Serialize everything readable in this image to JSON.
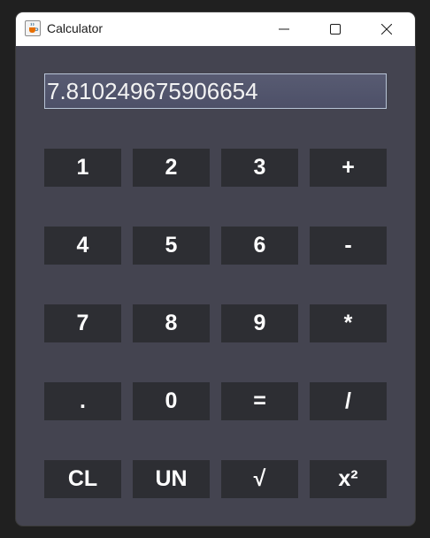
{
  "window": {
    "title": "Calculator",
    "icon": "java-cup-icon",
    "controls": [
      "minimize-icon",
      "maximize-icon",
      "close-icon"
    ]
  },
  "display": {
    "value": "7.810249675906654"
  },
  "keypad": {
    "rows": [
      [
        "1",
        "2",
        "3",
        "+"
      ],
      [
        "4",
        "5",
        "6",
        "-"
      ],
      [
        "7",
        "8",
        "9",
        "*"
      ],
      [
        ".",
        "0",
        "=",
        "/"
      ],
      [
        "CL",
        "UN",
        "√",
        "x²"
      ]
    ]
  },
  "colors": {
    "window_bg": "#444450",
    "key_bg": "#2d2e33",
    "key_text": "#ffffff",
    "display_bg": "#555870",
    "display_border": "#b8c4d6",
    "titlebar_bg": "#ffffff"
  }
}
